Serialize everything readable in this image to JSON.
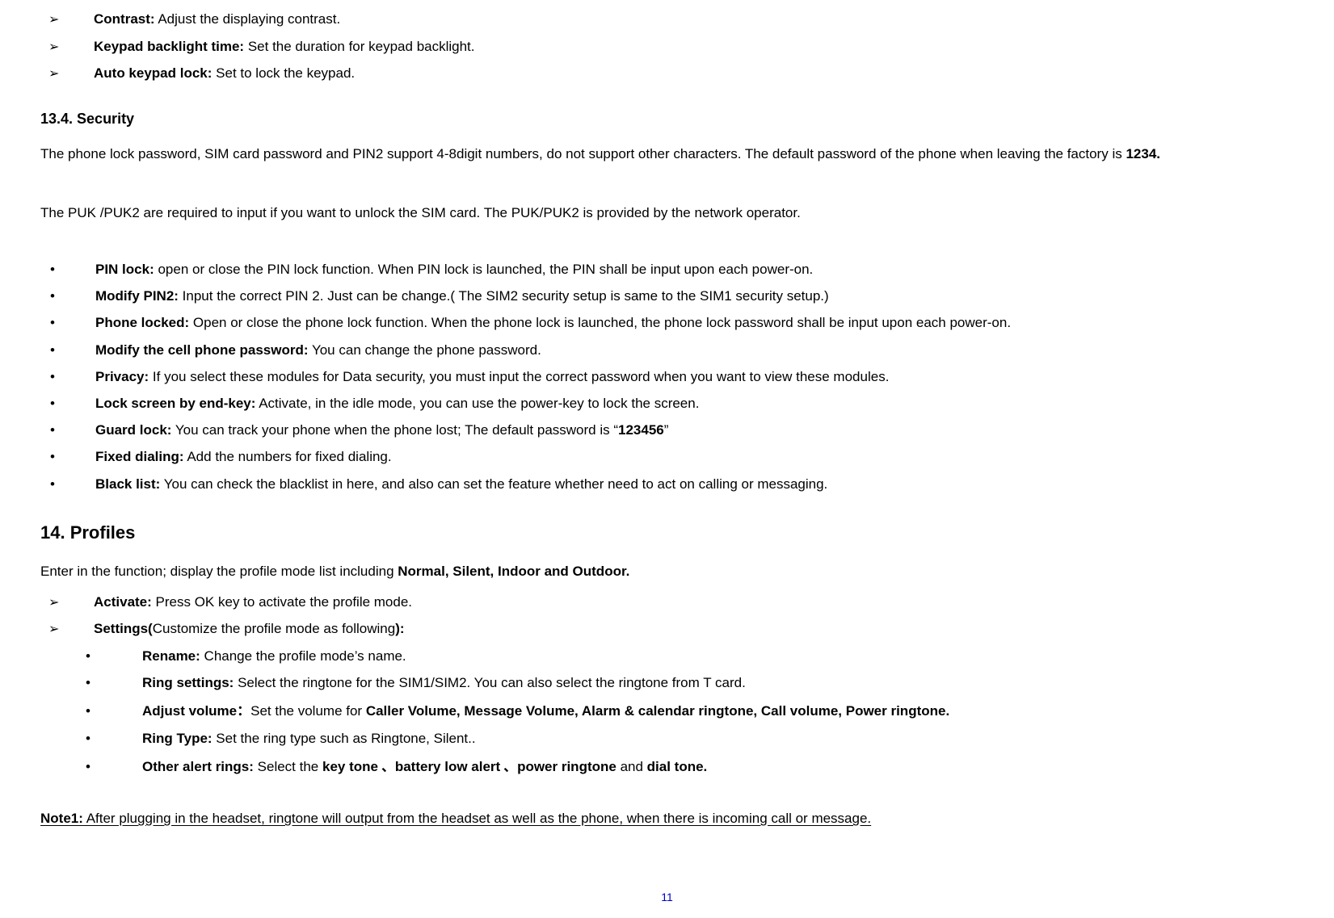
{
  "top_items": [
    {
      "label": "Contrast:",
      "desc": " Adjust the displaying contrast."
    },
    {
      "label": "Keypad backlight time:",
      "desc": " Set the duration for keypad backlight."
    },
    {
      "label": "Auto keypad lock:",
      "desc": " Set to lock the keypad."
    }
  ],
  "sec134_heading": "13.4.  Security",
  "sec134_para1a": "The phone lock password, SIM card password and PIN2 support 4-8digit numbers, do not support other characters. The default password of the phone when leaving the factory is ",
  "sec134_para1b": "1234.",
  "sec134_para2": "The PUK /PUK2 are required to input if you want to unlock the SIM card. The PUK/PUK2 is provided by the network operator.",
  "sec134_items": [
    {
      "label": "PIN lock:",
      "desc": " open or close the PIN lock function. When PIN lock is launched, the PIN shall be input upon each power-on."
    },
    {
      "label": "Modify PIN2:",
      "desc": " Input the correct PIN 2. Just can be change.( The SIM2 security setup is same to the SIM1 security setup.)"
    },
    {
      "label": "Phone locked:",
      "desc": " Open or close the phone lock function. When the phone lock is launched, the phone lock password shall be input upon each power-on."
    },
    {
      "label": "Modify the cell phone password:",
      "desc": " You can change the phone password."
    },
    {
      "label": "Privacy:",
      "desc": " If you select these modules for Data security, you must input the correct password when you want to view these modules."
    },
    {
      "label": "Lock screen by end-key:",
      "desc": " Activate, in the idle mode, you can use the power-key to lock the screen."
    },
    {
      "label": "Guard lock:",
      "pre": " You can track your phone when the phone lost; The default password is “",
      "mid": "123456",
      "post": "”"
    },
    {
      "label": "Fixed dialing:",
      "desc": " Add the numbers for fixed dialing."
    },
    {
      "label": "Black list:",
      "desc": " You can check the blacklist in here, and also can set the feature whether need to act on calling or messaging."
    }
  ],
  "sec14_heading": "14. Profiles",
  "sec14_intro_a": "Enter in the function; display the profile mode list including ",
  "sec14_intro_b": "Normal, Silent, Indoor and Outdoor.",
  "sec14_top": [
    {
      "label": "Activate:",
      "desc": " Press OK key to activate the profile mode."
    }
  ],
  "sec14_settings_a": "Settings(",
  "sec14_settings_b": "Customize the profile mode as following",
  "sec14_settings_c": "):",
  "sec14_sub": [
    {
      "label": "Rename:",
      "desc": " Change the profile mode’s name."
    },
    {
      "label": "Ring settings:",
      "desc": " Select the ringtone for the SIM1/SIM2. You can also select the ringtone from T card."
    },
    {
      "label_a": "Adjust volume",
      "label_b": "：",
      "pre": "Set the volume for ",
      "mid_a": "Caller Volume, Message",
      "mid_b": " Volume, Alarm & calendar ringtone, Call volume, Power ringtone."
    },
    {
      "label": "Ring Type:",
      "desc": " Set the ring type such as Ringtone, Silent.."
    },
    {
      "label": "Other alert rings:",
      "pre": " Select the ",
      "k1": "key tone",
      "s1": " 、",
      "k2": "battery low alert",
      "s2": " 、",
      "k3": "power ringtone",
      "mid": " and ",
      "k4": "dial tone."
    }
  ],
  "note_label": "Note1:",
  "note_text": " After plugging in the headset, ringtone will output from the headset as well as the phone, when there is incoming call or message.",
  "page_number": "11"
}
